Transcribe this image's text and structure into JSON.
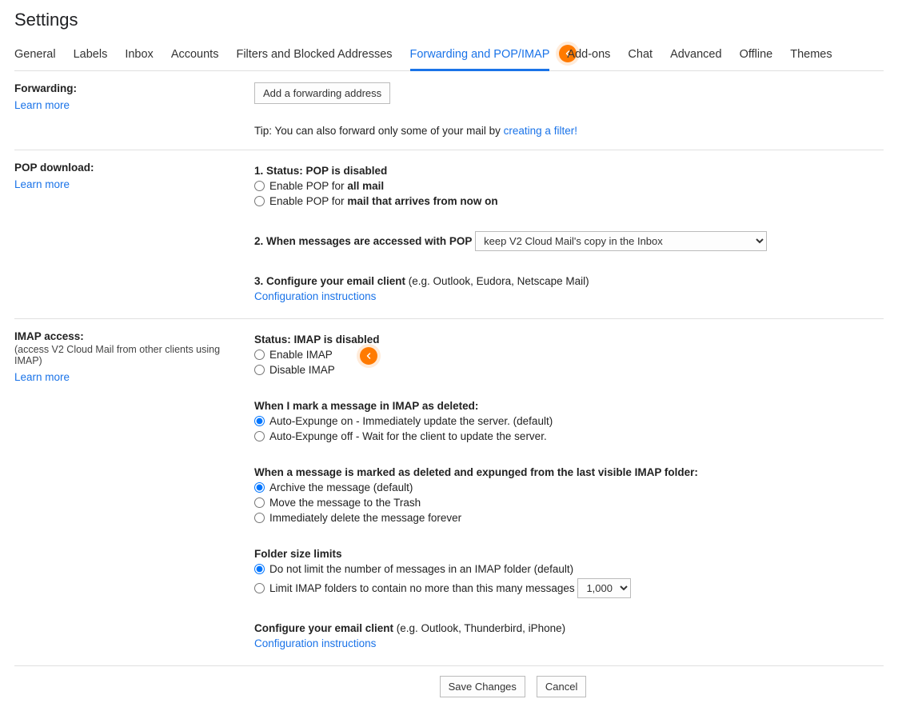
{
  "title": "Settings",
  "tabs": [
    "General",
    "Labels",
    "Inbox",
    "Accounts",
    "Filters and Blocked Addresses",
    "Forwarding and POP/IMAP",
    "Add-ons",
    "Chat",
    "Advanced",
    "Offline",
    "Themes"
  ],
  "active_tab_index": 5,
  "learn_more": "Learn more",
  "forwarding": {
    "header": "Forwarding:",
    "button": "Add a forwarding address",
    "tip_prefix": "Tip: You can also forward only some of your mail by ",
    "tip_link": "creating a filter!"
  },
  "pop": {
    "header": "POP download:",
    "status_prefix": "1. Status: ",
    "status_value": "POP is disabled",
    "opt1_prefix": "Enable POP for ",
    "opt1_bold": "all mail",
    "opt2_prefix": "Enable POP for ",
    "opt2_bold": "mail that arrives from now on",
    "step2": "2. When messages are accessed with POP",
    "select_value": "keep V2 Cloud Mail's copy in the Inbox",
    "step3_bold": "3. Configure your email client",
    "step3_rest": " (e.g. Outlook, Eudora, Netscape Mail)",
    "config_link": "Configuration instructions"
  },
  "imap": {
    "header": "IMAP access:",
    "sub": "(access V2 Cloud Mail from other clients using IMAP)",
    "status_prefix": "Status: ",
    "status_value": "IMAP is disabled",
    "enable": "Enable IMAP",
    "disable": "Disable IMAP",
    "deleted_header": "When I mark a message in IMAP as deleted:",
    "expunge_on": "Auto-Expunge on - Immediately update the server. (default)",
    "expunge_off": "Auto-Expunge off - Wait for the client to update the server.",
    "expunged_header": "When a message is marked as deleted and expunged from the last visible IMAP folder:",
    "expunged_opt1": "Archive the message (default)",
    "expunged_opt2": "Move the message to the Trash",
    "expunged_opt3": "Immediately delete the message forever",
    "folder_header": "Folder size limits",
    "folder_opt1": "Do not limit the number of messages in an IMAP folder (default)",
    "folder_opt2": "Limit IMAP folders to contain no more than this many messages",
    "folder_select": "1,000",
    "configure_bold": "Configure your email client",
    "configure_rest": " (e.g. Outlook, Thunderbird, iPhone)",
    "config_link": "Configuration instructions"
  },
  "buttons": {
    "save": "Save Changes",
    "cancel": "Cancel"
  }
}
